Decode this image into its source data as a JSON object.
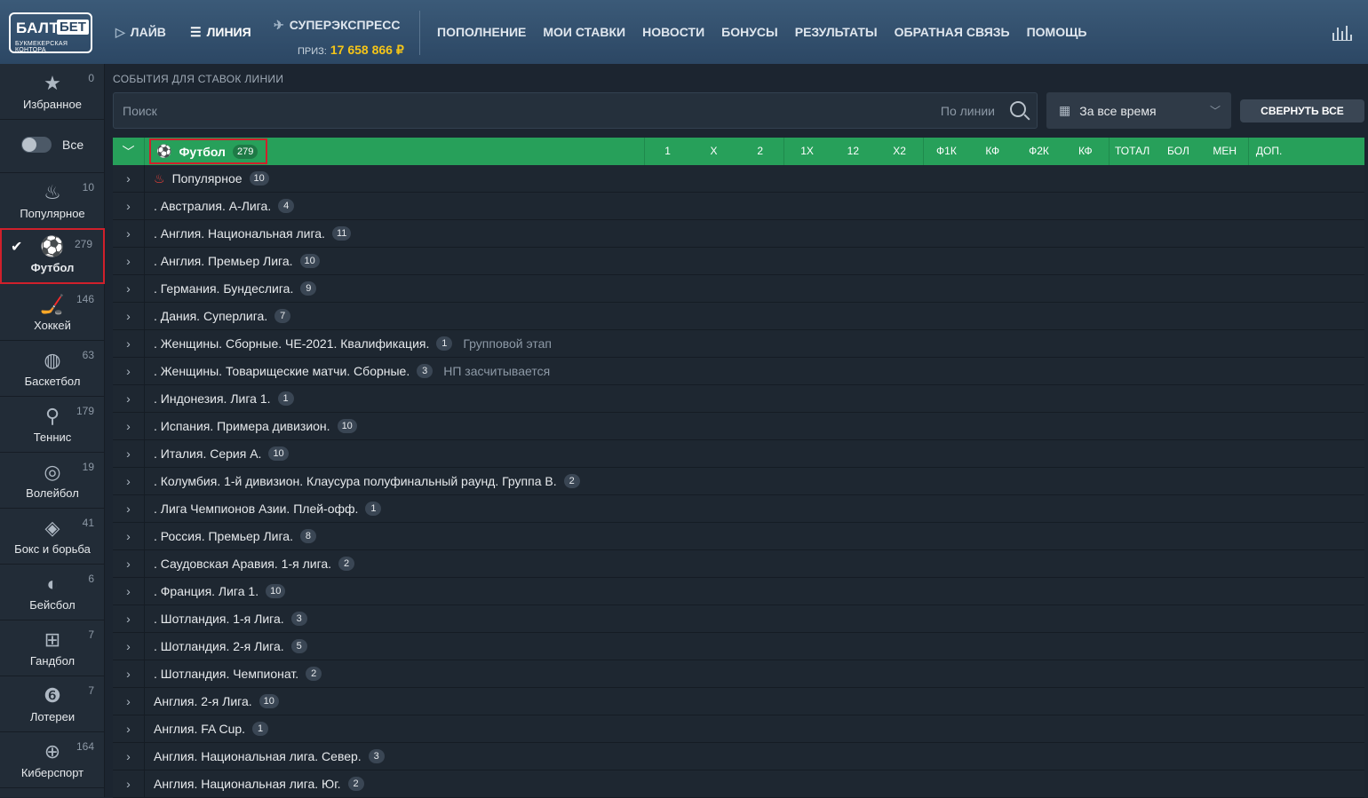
{
  "header": {
    "logo_top": "БАЛТ",
    "logo_box": "БЕТ",
    "logo_sub": "БУКМЕКЕРСКАЯ КОНТОРА",
    "live": "ЛАЙВ",
    "line": "ЛИНИЯ",
    "superexpress": "СУПЕРЭКСПРЕСС",
    "prize_label": "ПРИЗ:",
    "prize_value": "17 658 866 ₽",
    "menu": [
      "ПОПОЛНЕНИЕ",
      "МОИ СТАВКИ",
      "НОВОСТИ",
      "БОНУСЫ",
      "РЕЗУЛЬТАТЫ",
      "ОБРАТНАЯ СВЯЗЬ",
      "ПОМОЩЬ"
    ]
  },
  "sidebar": {
    "favorites": {
      "label": "Избранное",
      "count": "0"
    },
    "toggle_label": "Все",
    "items": [
      {
        "label": "Популярное",
        "count": "10",
        "icon": "fire-icon"
      },
      {
        "label": "Футбол",
        "count": "279",
        "icon": "soccer-ball-icon",
        "active": true
      },
      {
        "label": "Хоккей",
        "count": "146",
        "icon": "hockey-icon"
      },
      {
        "label": "Баскетбол",
        "count": "63",
        "icon": "basketball-icon"
      },
      {
        "label": "Теннис",
        "count": "179",
        "icon": "tennis-icon"
      },
      {
        "label": "Волейбол",
        "count": "19",
        "icon": "volleyball-icon"
      },
      {
        "label": "Бокс и борьба",
        "count": "41",
        "icon": "boxing-ring-icon"
      },
      {
        "label": "Бейсбол",
        "count": "6",
        "icon": "baseball-icon"
      },
      {
        "label": "Гандбол",
        "count": "7",
        "icon": "handball-icon"
      },
      {
        "label": "Лотереи",
        "count": "7",
        "icon": "lottery-ball-icon"
      },
      {
        "label": "Киберспорт",
        "count": "164",
        "icon": "esports-icon"
      }
    ]
  },
  "main": {
    "title": "СОБЫТИЯ ДЛЯ СТАВОК ЛИНИИ",
    "search_placeholder": "Поиск",
    "search_mode": "По линии",
    "period": "За все время",
    "collapse_all": "СВЕРНУТЬ ВСЕ",
    "sport_header": {
      "name": "Футбол",
      "count": "279"
    },
    "columns": [
      "1",
      "X",
      "2",
      "1X",
      "12",
      "X2",
      "Ф1К",
      "КФ",
      "Ф2К",
      "КФ",
      "ТОТАЛ",
      "БОЛ",
      "МЕН",
      "ДОП."
    ],
    "rows": [
      {
        "name": "Популярное",
        "count": "10",
        "fire": true
      },
      {
        "name": ". Австралия. А-Лига.",
        "count": "4"
      },
      {
        "name": ". Англия. Национальная лига.",
        "count": "11"
      },
      {
        "name": ". Англия. Премьер Лига.",
        "count": "10"
      },
      {
        "name": ". Германия. Бундеслига.",
        "count": "9"
      },
      {
        "name": ". Дания. Суперлига.",
        "count": "7"
      },
      {
        "name": ". Женщины. Сборные. ЧЕ-2021. Квалификация.",
        "count": "1",
        "note": "Групповой этап"
      },
      {
        "name": ". Женщины. Товарищеские матчи. Сборные.",
        "count": "3",
        "note": "НП засчитывается"
      },
      {
        "name": ". Индонезия. Лига 1.",
        "count": "1"
      },
      {
        "name": ". Испания. Примера дивизион.",
        "count": "10"
      },
      {
        "name": ". Италия. Серия А.",
        "count": "10"
      },
      {
        "name": ". Колумбия. 1-й дивизион. Клаусура полуфинальный раунд. Группа В.",
        "count": "2"
      },
      {
        "name": ". Лига Чемпионов Азии. Плей-офф.",
        "count": "1"
      },
      {
        "name": ". Россия. Премьер Лига.",
        "count": "8"
      },
      {
        "name": ". Саудовская Аравия. 1-я лига.",
        "count": "2"
      },
      {
        "name": ". Франция. Лига 1.",
        "count": "10"
      },
      {
        "name": ". Шотландия. 1-я Лига.",
        "count": "3"
      },
      {
        "name": ". Шотландия. 2-я Лига.",
        "count": "5"
      },
      {
        "name": ". Шотландия. Чемпионат.",
        "count": "2"
      },
      {
        "name": "Англия. 2-я Лига.",
        "count": "10"
      },
      {
        "name": "Англия. FA Cup.",
        "count": "1"
      },
      {
        "name": "Англия. Национальная лига. Север.",
        "count": "3"
      },
      {
        "name": "Англия. Национальная лига. Юг.",
        "count": "2"
      }
    ]
  }
}
